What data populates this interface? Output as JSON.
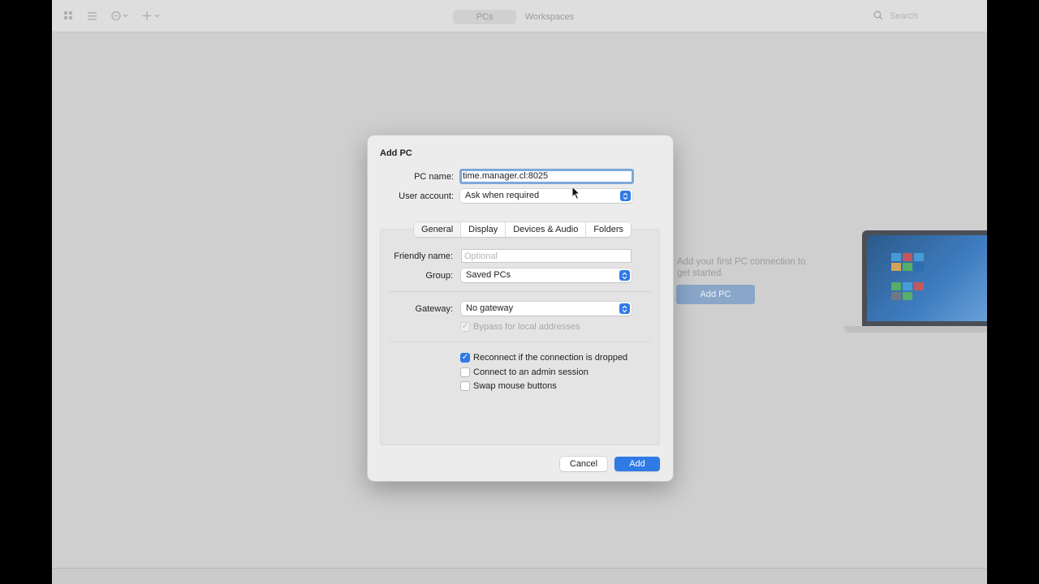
{
  "toolbar": {
    "icons": [
      "grid-view-icon",
      "list-view-icon",
      "more-options-icon",
      "add-icon"
    ],
    "segments": [
      {
        "label": "PCs",
        "selected": true
      },
      {
        "label": "Workspaces",
        "selected": false
      }
    ],
    "search_placeholder": "Search"
  },
  "empty_state": {
    "message": "Add your first PC connection to get started.",
    "button_label": "Add PC"
  },
  "dialog": {
    "title": "Add PC",
    "pc_name_label": "PC name:",
    "pc_name_value": "time.manager.cl:8025",
    "user_account_label": "User account:",
    "user_account_value": "Ask when required",
    "tabs": [
      {
        "label": "General",
        "selected": true
      },
      {
        "label": "Display",
        "selected": false
      },
      {
        "label": "Devices & Audio",
        "selected": false
      },
      {
        "label": "Folders",
        "selected": false
      }
    ],
    "friendly_name_label": "Friendly name:",
    "friendly_name_placeholder": "Optional",
    "group_label": "Group:",
    "group_value": "Saved PCs",
    "gateway_label": "Gateway:",
    "gateway_value": "No gateway",
    "bypass_label": "Bypass for local addresses",
    "options": [
      {
        "label": "Reconnect if the connection is dropped",
        "checked": true
      },
      {
        "label": "Connect to an admin session",
        "checked": false
      },
      {
        "label": "Swap mouse buttons",
        "checked": false
      }
    ],
    "cancel_label": "Cancel",
    "add_label": "Add"
  },
  "colors": {
    "accent": "#2f7ae5",
    "focus_ring": "#7ea8dd"
  }
}
